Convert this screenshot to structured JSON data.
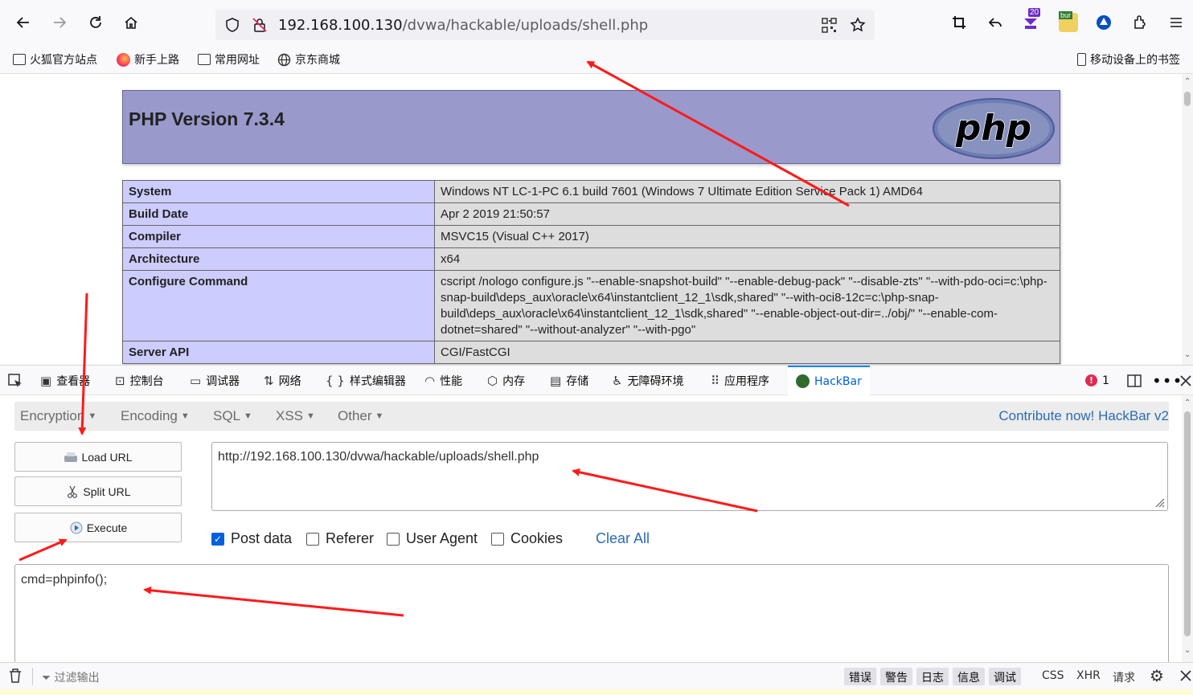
{
  "toolbar": {
    "url_host": "192.168.100.130",
    "url_path": "/dvwa/hackable/uploads/shell.php",
    "ext_badge": "20",
    "ext_bur": "bur"
  },
  "bookmarks": [
    {
      "label": "火狐官方站点",
      "icon": "folder-icon"
    },
    {
      "label": "新手上路",
      "icon": "firefox-icon"
    },
    {
      "label": "常用网址",
      "icon": "folder-icon"
    },
    {
      "label": "京东商城",
      "icon": "globe-icon"
    }
  ],
  "mobile_bookmarks": "移动设备上的书签",
  "php": {
    "title": "PHP Version 7.3.4",
    "logo_text": "php",
    "rows": [
      {
        "key": "System",
        "value": "Windows NT LC-1-PC 6.1 build 7601 (Windows 7 Ultimate Edition Service Pack 1) AMD64"
      },
      {
        "key": "Build Date",
        "value": "Apr 2 2019 21:50:57"
      },
      {
        "key": "Compiler",
        "value": "MSVC15 (Visual C++ 2017)"
      },
      {
        "key": "Architecture",
        "value": "x64"
      },
      {
        "key": "Configure Command",
        "value": "cscript /nologo configure.js \"--enable-snapshot-build\" \"--enable-debug-pack\" \"--disable-zts\" \"--with-pdo-oci=c:\\php-snap-build\\deps_aux\\oracle\\x64\\instantclient_12_1\\sdk,shared\" \"--with-oci8-12c=c:\\php-snap-build\\deps_aux\\oracle\\x64\\instantclient_12_1\\sdk,shared\" \"--enable-object-out-dir=../obj/\" \"--enable-com-dotnet=shared\" \"--without-analyzer\" \"--with-pgo\""
      },
      {
        "key": "Server API",
        "value": "CGI/FastCGI"
      }
    ]
  },
  "devtools": {
    "tabs": [
      "查看器",
      "控制台",
      "调试器",
      "网络",
      "样式编辑器",
      "性能",
      "内存",
      "存储",
      "无障碍环境",
      "应用程序",
      "HackBar"
    ],
    "error_count": "1"
  },
  "hackbar": {
    "menu": [
      "Encryption",
      "Encoding",
      "SQL",
      "XSS",
      "Other"
    ],
    "contribute": "Contribute now! HackBar v2",
    "load_url": "Load URL",
    "split_url": "Split URL",
    "execute": "Execute",
    "url_value": "http://192.168.100.130/dvwa/hackable/uploads/shell.php",
    "post_data_label": "Post data",
    "referer_label": "Referer",
    "user_agent_label": "User Agent",
    "cookies_label": "Cookies",
    "clear_all": "Clear All",
    "post_value": "cmd=phpinfo();"
  },
  "console": {
    "filter_placeholder": "过滤输出",
    "levels": [
      "错误",
      "警告",
      "日志",
      "信息",
      "调试"
    ],
    "extra": [
      "CSS",
      "XHR",
      "请求"
    ]
  },
  "colors": {
    "php_header": "#9999cc",
    "php_key_bg": "#ccccff",
    "php_val_bg": "#dddddd",
    "accent": "#0060df",
    "annotation_arrow": "#ff1a1a"
  }
}
